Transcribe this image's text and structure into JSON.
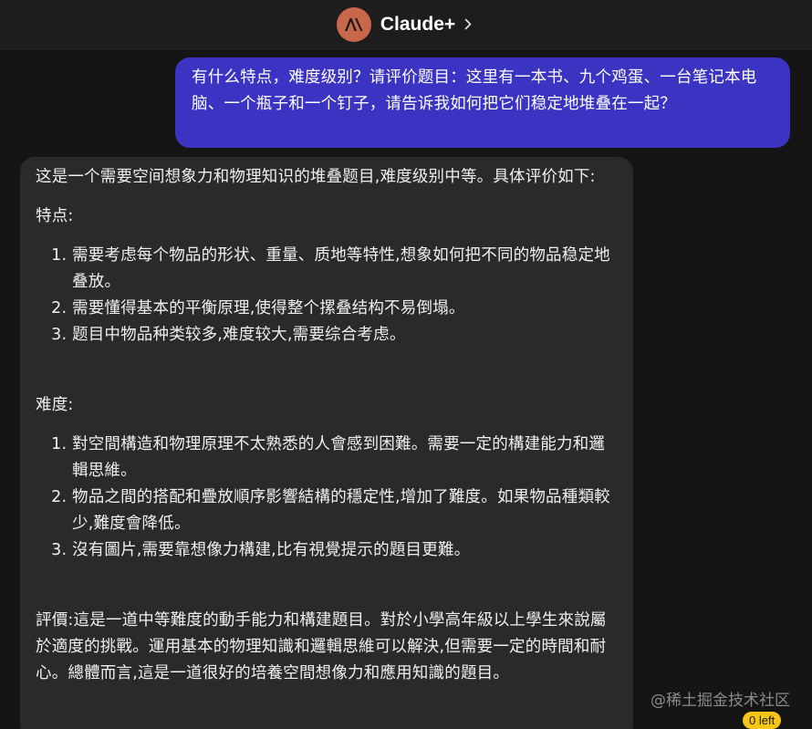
{
  "header": {
    "bot_name": "Claude+",
    "avatar_icon": "anthropic-logo-icon",
    "avatar_color": "#c8674a"
  },
  "user_message": {
    "text": "有什么特点，难度级别？请评价题目：这里有一本书、九个鸡蛋、一台笔记本电脑、一个瓶子和一个钉子，请告诉我如何把它们稳定地堆叠在一起？",
    "bubble_color": "#3b33c2"
  },
  "bot_message": {
    "intro": "这是一个需要空间想象力和物理知识的堆叠题目,难度级别中等。具体评价如下:",
    "features_heading": "特点:",
    "features": [
      "需要考虑每个物品的形状、重量、质地等特性,想象如何把不同的物品稳定地叠放。",
      "需要懂得基本的平衡原理,使得整个摞叠结构不易倒塌。",
      "题目中物品种类较多,难度较大,需要综合考虑。"
    ],
    "difficulty_heading": "难度:",
    "difficulty": [
      "對空間構造和物理原理不太熟悉的人會感到困難。需要一定的構建能力和邏輯思維。",
      "物品之間的搭配和疊放順序影響結構的穩定性,增加了難度。如果物品種類較少,難度會降低。",
      "沒有圖片,需要靠想像力構建,比有視覺提示的題目更難。"
    ],
    "evaluation": "評價:這是一道中等難度的動手能力和構建題目。對於小學高年級以上學生來說屬於適度的挑戰。運用基本的物理知識和邏輯思維可以解決,但需要一定的時間和耐心。總體而言,這是一道很好的培養空間想像力和應用知識的題目。",
    "bubble_color": "#2a2a2a"
  },
  "watermark": "@稀土掘金技术社区",
  "remaining_badge": "0 left",
  "colors": {
    "background": "#151515",
    "header_bg": "#1d1d1d",
    "badge": "#f6c51a"
  }
}
